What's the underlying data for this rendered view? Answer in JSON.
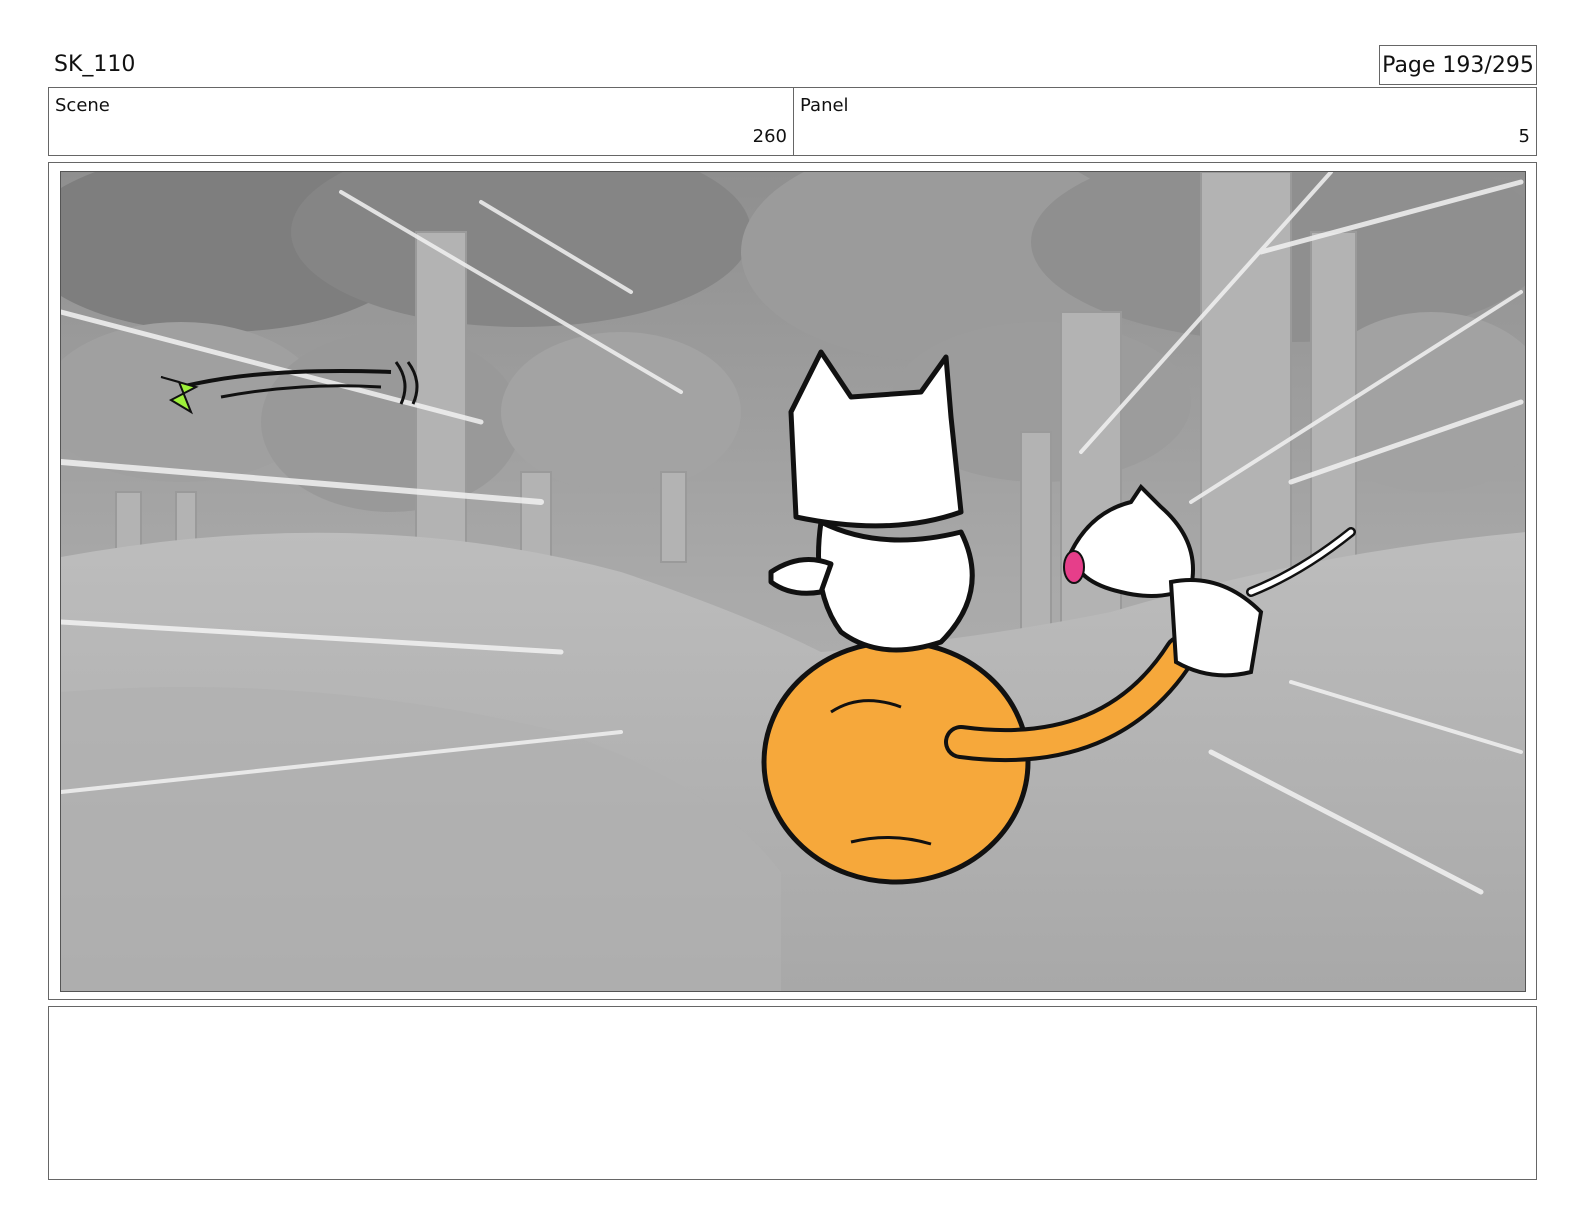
{
  "header": {
    "doc_id": "SK_110",
    "page_label": "Page 193/295"
  },
  "scene": {
    "label": "Scene",
    "value": "260"
  },
  "panel": {
    "label": "Panel",
    "value": "5"
  },
  "notes": {
    "text": ""
  }
}
